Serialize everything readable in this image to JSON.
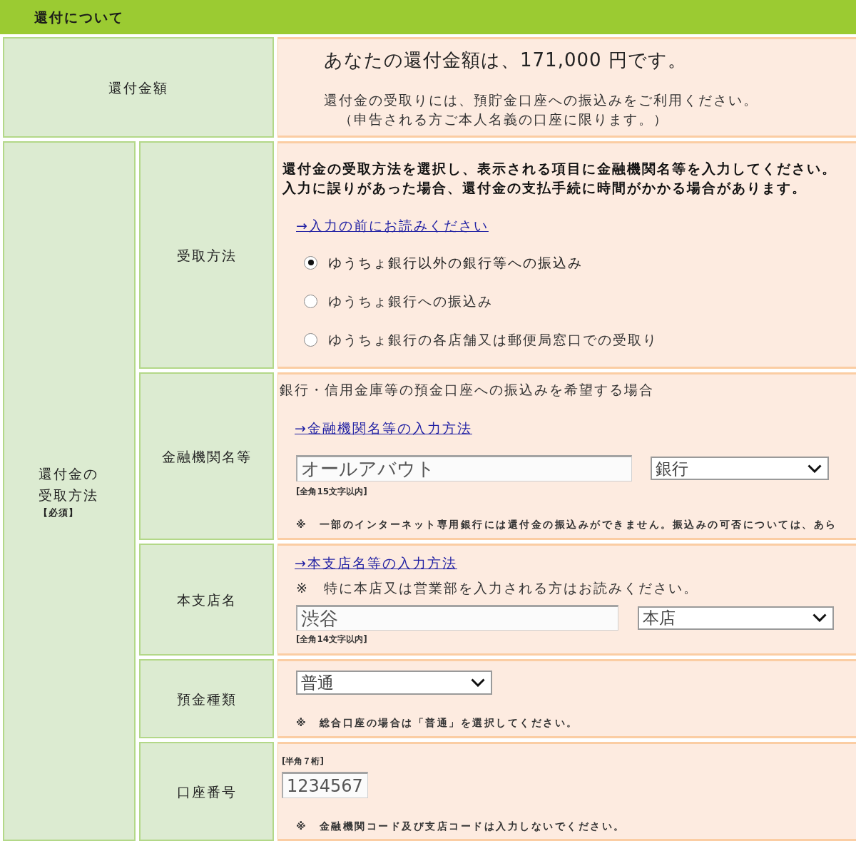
{
  "header": {
    "title": "還付について"
  },
  "refund_amount": {
    "label": "還付金額",
    "headline": "あなたの還付金額は、171,000 円です。",
    "notes": [
      "還付金の受取りには、預貯金口座への振込みをご利用ください。",
      "（申告される方ご本人名義の口座に限ります。）"
    ]
  },
  "receipt_method": {
    "label": "還付金の受取方法",
    "required_tag": "【必須】",
    "rows": [
      {
        "kind": "method",
        "label": "受取方法",
        "instructions": [
          "還付金の受取方法を選択し、表示される項目に金融機関名等を入力してください。",
          "入力に誤りがあった場合、還付金の支払手続に時間がかかる場合があります。"
        ],
        "link": "→入力の前にお読みください",
        "options": [
          {
            "label": "ゆうちょ銀行以外の銀行等への振込み",
            "selected": true
          },
          {
            "label": "ゆうちょ銀行への振込み",
            "selected": false
          },
          {
            "label": "ゆうちょ銀行の各店舗又は郵便局窓口での受取り",
            "selected": false
          }
        ]
      },
      {
        "kind": "institution",
        "label": "金融機関名等",
        "intro": "銀行・信用金庫等の預金口座への振込みを希望する場合",
        "link": "→金融機関名等の入力方法",
        "text_field": "オールアバウト",
        "select": "銀行",
        "hint": "[全角15文字以内]",
        "note": "※　一部のインターネット専用銀行には還付金の振込みができません。振込みの可否については、あら"
      },
      {
        "kind": "branch",
        "label": "本支店名",
        "link": "→本支店名等の入力方法",
        "notice": "※　特に本店又は営業部を入力される方はお読みください。",
        "text_field": "渋谷",
        "select": "本店",
        "hint": "[全角14文字以内]"
      },
      {
        "kind": "account_type",
        "label": "預金種類",
        "select": "普通",
        "note": "※　総合口座の場合は「普通」を選択してください。"
      },
      {
        "kind": "account_number",
        "label": "口座番号",
        "hint": "[半角７桁]",
        "text_field": "1234567",
        "note": "※　金融機関コード及び支店コードは入力しないでください。"
      }
    ]
  }
}
